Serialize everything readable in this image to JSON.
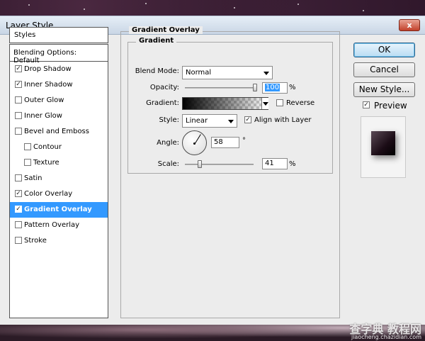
{
  "window": {
    "title": "Layer Style",
    "close_glyph": "x"
  },
  "styles_panel": {
    "header": "Styles",
    "blending_options": "Blending Options: Default",
    "items": [
      {
        "label": "Drop Shadow",
        "checked": true,
        "indent": false,
        "selected": false
      },
      {
        "label": "Inner Shadow",
        "checked": true,
        "indent": false,
        "selected": false
      },
      {
        "label": "Outer Glow",
        "checked": false,
        "indent": false,
        "selected": false
      },
      {
        "label": "Inner Glow",
        "checked": false,
        "indent": false,
        "selected": false
      },
      {
        "label": "Bevel and Emboss",
        "checked": false,
        "indent": false,
        "selected": false
      },
      {
        "label": "Contour",
        "checked": false,
        "indent": true,
        "selected": false
      },
      {
        "label": "Texture",
        "checked": false,
        "indent": true,
        "selected": false
      },
      {
        "label": "Satin",
        "checked": false,
        "indent": false,
        "selected": false
      },
      {
        "label": "Color Overlay",
        "checked": true,
        "indent": false,
        "selected": false
      },
      {
        "label": "Gradient Overlay",
        "checked": true,
        "indent": false,
        "selected": true
      },
      {
        "label": "Pattern Overlay",
        "checked": false,
        "indent": false,
        "selected": false
      },
      {
        "label": "Stroke",
        "checked": false,
        "indent": false,
        "selected": false
      }
    ]
  },
  "gradient_overlay": {
    "section_title": "Gradient Overlay",
    "group_title": "Gradient",
    "blend_mode": {
      "label": "Blend Mode:",
      "value": "Normal"
    },
    "opacity": {
      "label": "Opacity:",
      "value": "100",
      "unit": "%",
      "fraction": 1.0
    },
    "gradient": {
      "label": "Gradient:",
      "reverse_label": "Reverse",
      "reverse_checked": false
    },
    "style": {
      "label": "Style:",
      "value": "Linear",
      "align_label": "Align with Layer",
      "align_checked": true
    },
    "angle": {
      "label": "Angle:",
      "value": "58",
      "unit": "°"
    },
    "scale": {
      "label": "Scale:",
      "value": "41",
      "unit": "%",
      "fraction": 0.1
    }
  },
  "buttons": {
    "ok": "OK",
    "cancel": "Cancel",
    "new_style": "New Style...",
    "preview_label": "Preview",
    "preview_checked": true
  },
  "watermark": {
    "text": "查字典 教程网",
    "url": "jiaocheng.chazidian.com"
  },
  "colors": {
    "selection": "#3399ff",
    "dialog_bg": "#ececec",
    "title_bar": "#c9d6e5"
  }
}
